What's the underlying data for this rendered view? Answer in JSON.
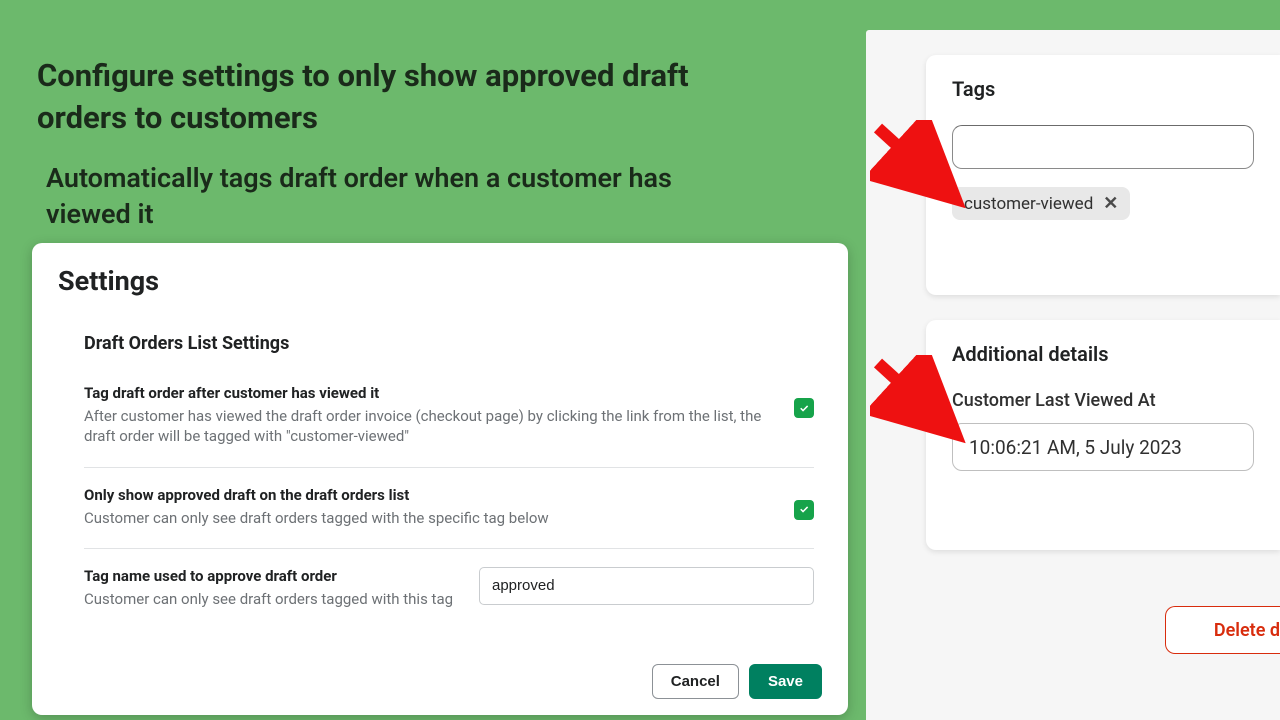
{
  "marketing": {
    "title": "Configure settings to only show approved draft orders to customers",
    "subtitle": "Automatically tags draft order when a customer has viewed it"
  },
  "settings": {
    "title": "Settings",
    "section_title": "Draft Orders List Settings",
    "row1": {
      "label": "Tag draft order after customer has viewed it",
      "desc": "After customer has viewed the draft order invoice (checkout page) by clicking the link from the list, the draft order will be tagged with \"customer-viewed\""
    },
    "row2": {
      "label": "Only show approved draft on the draft orders list",
      "desc": "Customer can only see draft orders tagged with the specific tag below"
    },
    "row3": {
      "label": "Tag name used to approve draft order",
      "desc": "Customer can only see draft orders tagged with this tag",
      "value": "approved"
    },
    "cancel_label": "Cancel",
    "save_label": "Save"
  },
  "tags_card": {
    "heading": "Tags",
    "chip": "customer-viewed"
  },
  "details_card": {
    "heading": "Additional details",
    "label": "Customer Last Viewed At",
    "value": "10:06:21 AM, 5 July 2023"
  },
  "delete": {
    "label": "Delete d"
  }
}
